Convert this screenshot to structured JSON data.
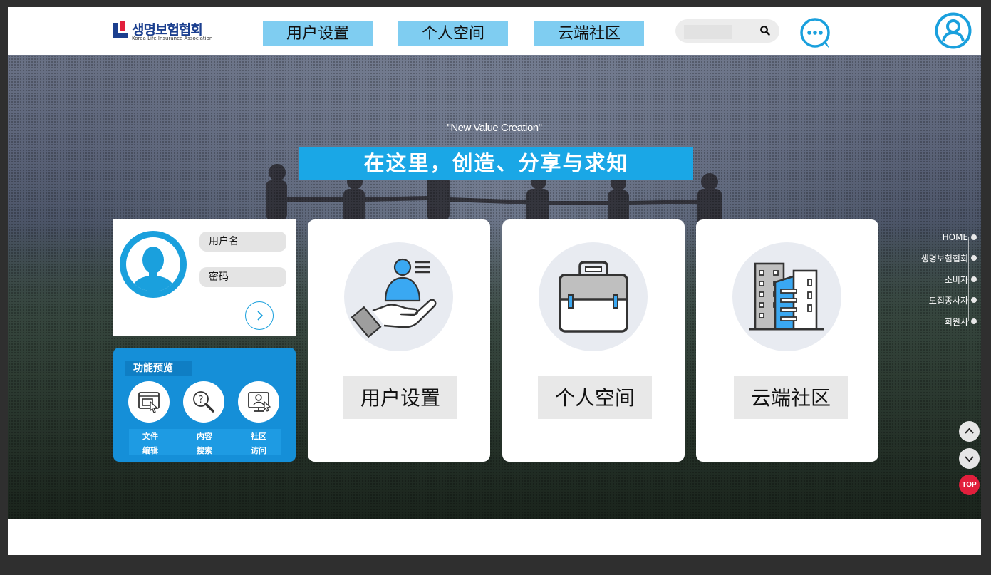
{
  "header": {
    "logo_text": "생명보험협회",
    "logo_subtext": "Korea Life Insurance Association",
    "nav": [
      "用户设置",
      "个人空间",
      "云端社区"
    ],
    "search_placeholder": ""
  },
  "hero": {
    "tagline": "\"New Value Creation\"",
    "banner": "在这里，创造、分享与求知"
  },
  "login": {
    "username_placeholder": "用户名",
    "password_placeholder": "密码"
  },
  "preview": {
    "title": "功能预览",
    "items": [
      {
        "line1": "文件",
        "line2": "编辑",
        "icon": "file-edit-icon"
      },
      {
        "line1": "内容",
        "line2": "搜索",
        "icon": "content-search-icon"
      },
      {
        "line1": "社区",
        "line2": "访问",
        "icon": "community-visit-icon"
      }
    ]
  },
  "cards": [
    {
      "label": "用户设置",
      "icon": "hand-user-icon"
    },
    {
      "label": "个人空间",
      "icon": "briefcase-icon"
    },
    {
      "label": "云端社区",
      "icon": "buildings-icon"
    }
  ],
  "sidenav": [
    "HOME",
    "생명보험협회",
    "소비자",
    "모집종사자",
    "회원사"
  ],
  "top_label": "TOP",
  "colors": {
    "accent": "#1aa7e6",
    "nav_bg": "#7fcdf1",
    "preview_bg": "#158fd8",
    "top_button": "#e21f3c"
  }
}
